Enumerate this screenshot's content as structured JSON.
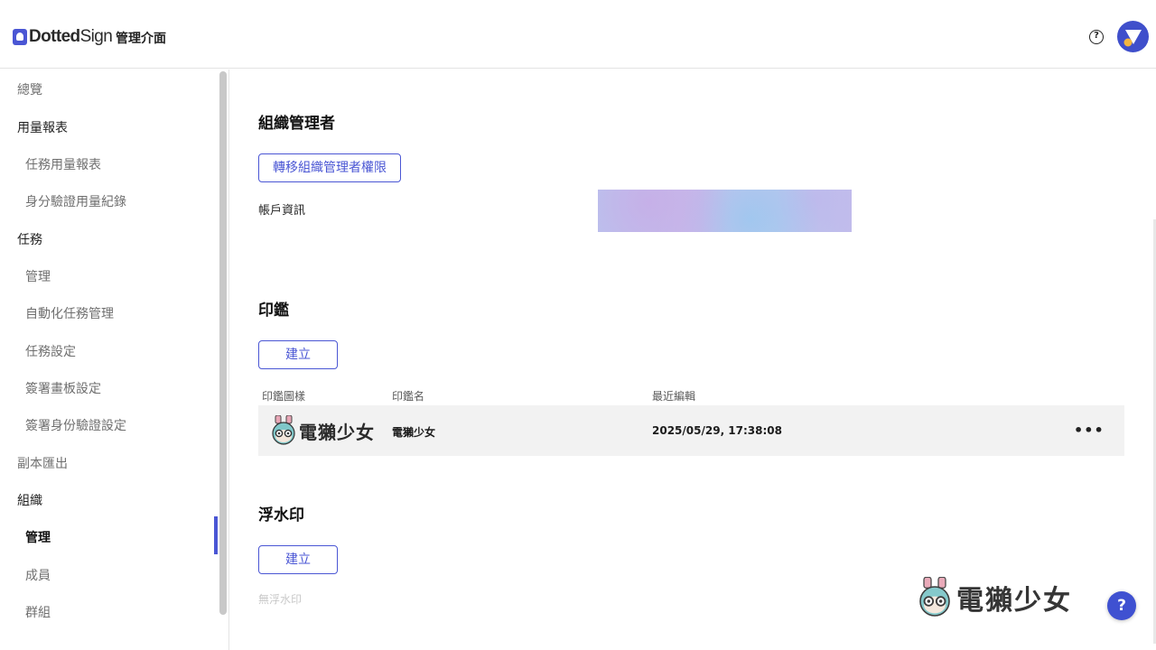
{
  "header": {
    "logo_bold": "Dotted",
    "logo_light": "Sign",
    "title": "管理介面",
    "help_glyph": "?"
  },
  "sidebar": {
    "items": [
      {
        "label": "總覽"
      },
      {
        "label": "用量報表"
      },
      {
        "label": "任務用量報表"
      },
      {
        "label": "身分驗證用量紀錄"
      },
      {
        "label": "任務"
      },
      {
        "label": "管理"
      },
      {
        "label": "自動化任務管理"
      },
      {
        "label": "任務設定"
      },
      {
        "label": "簽署畫板設定"
      },
      {
        "label": "簽署身份驗證設定"
      },
      {
        "label": "副本匯出"
      },
      {
        "label": "組織"
      },
      {
        "label": "管理"
      },
      {
        "label": "成員"
      },
      {
        "label": "群組"
      }
    ],
    "active_index": 12
  },
  "org_admin": {
    "heading": "組織管理者",
    "transfer_button": "轉移組織管理者權限",
    "account_label": "帳戶資訊"
  },
  "seals": {
    "heading": "印鑑",
    "create_button": "建立",
    "columns": [
      "印鑑圖樣",
      "印鑑名",
      "最近編輯"
    ],
    "rows": [
      {
        "image_text": "電獺少女",
        "name": "電獺少女",
        "last_edited": "2025/05/29, 17:38:08",
        "more": "•••"
      }
    ]
  },
  "watermarks": {
    "heading": "浮水印",
    "create_button": "建立",
    "empty_text": "無浮水印"
  },
  "overlay": {
    "watermark_text": "電獺少女",
    "fab_glyph": "?"
  },
  "colors": {
    "accent": "#4a56d4",
    "fab": "#3f51d1"
  }
}
